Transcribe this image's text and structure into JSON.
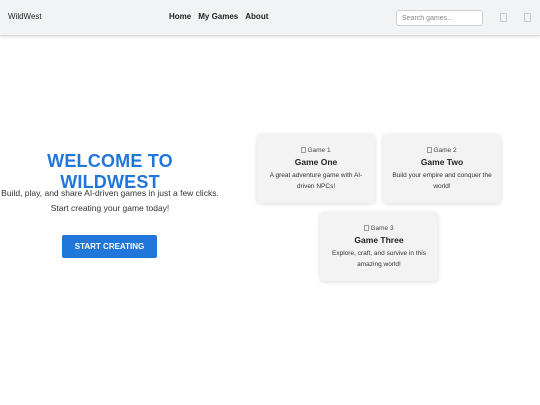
{
  "navbar": {
    "brand": "WildWest",
    "links": [
      {
        "label": "Home"
      },
      {
        "label": "My Games"
      },
      {
        "label": "About"
      }
    ],
    "search": {
      "placeholder": "Search games...",
      "value": ""
    }
  },
  "hero": {
    "title": "WELCOME TO WILDWEST",
    "subtitle_line1": "Build, play, and share AI-driven games in just a few clicks.",
    "subtitle_line2": "Start creating your game today!",
    "cta_label": "START CREATING"
  },
  "games": [
    {
      "image_alt": "Game 1",
      "title": "Game One",
      "description": "A great adventure game with AI-driven NPCs!"
    },
    {
      "image_alt": "Game 2",
      "title": "Game Two",
      "description": "Build your empire and conquer the world!"
    },
    {
      "image_alt": "Game 3",
      "title": "Game Three",
      "description": "Explore, craft, and survive in this amazing world!"
    }
  ],
  "colors": {
    "accent": "#2176d9",
    "navbar_bg": "#f2f3f5",
    "card_bg": "#f3f3f4"
  }
}
